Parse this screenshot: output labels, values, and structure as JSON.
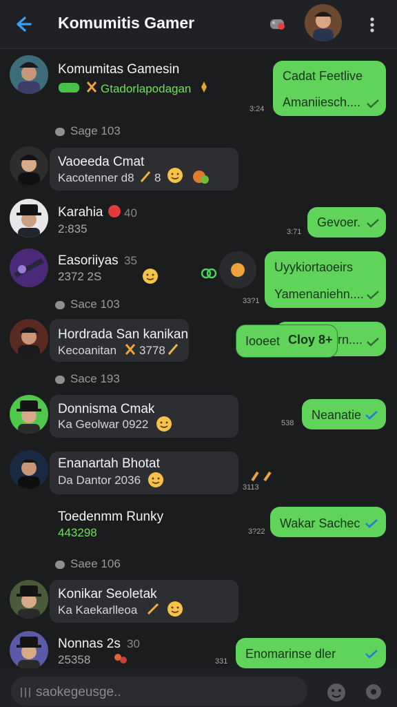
{
  "header": {
    "title": "Komumitis Gamer"
  },
  "rows": [
    {
      "name": "Komumitas Gamesin",
      "sub": "Gtadorlapodagan",
      "out1": "Cadat Feetlive",
      "out2": "Amaniiesch....",
      "time": "3:24"
    },
    {
      "name": "Vaoeeda Cmat",
      "sub": "Kacotenner d8",
      "sub_tail": "8"
    },
    {
      "name": "Karahia",
      "name_suffix": "40",
      "sub": "2:835",
      "out1": "Gevoer.",
      "time": "3:71"
    },
    {
      "name": "Easoriiyas",
      "name_suffix": "35",
      "sub": "2372 2S",
      "out1": "Uyykiortaoeirs",
      "out2": "Yamenaniehn....",
      "time": "33?1"
    },
    {
      "name": "Hordrada San kanikan",
      "sub": "Kecoanitan",
      "sub_tail": "3778",
      "out1": "Iooeet",
      "out1b": "Cloy 8+",
      "out2": "rn...."
    },
    {
      "name": "Donnisma Cmak",
      "sub": "Ka Geolwar 0922",
      "out1": "Neanatie",
      "time": "538"
    },
    {
      "name": "Enanartah Bhotat",
      "sub": "Da Dantor 2036",
      "time": "3113"
    },
    {
      "name": "Toedenmm Runky",
      "sub": "443298",
      "out1": "Wakar Sachec",
      "time": "3?22"
    },
    {
      "name": "Konikar Seoletak",
      "sub": "Ka Kaekarlleoa"
    },
    {
      "name": "Nonnas 2s",
      "name_suffix": "30",
      "sub": "25358",
      "out1": "Enomarinse dler",
      "time": "331"
    }
  ],
  "separators": [
    "Sage 103",
    "Sace 103",
    "Sace 193",
    "Saee 106"
  ],
  "composer": {
    "placeholder": "saokegeusge.."
  }
}
